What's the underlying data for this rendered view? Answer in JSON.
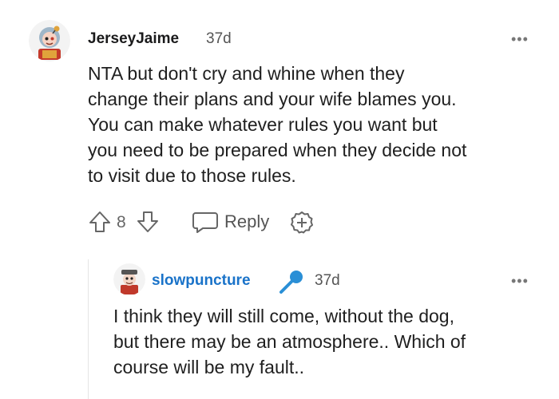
{
  "comment": {
    "username": "JerseyJaime",
    "age": "37d",
    "body": [
      "NTA but don't cry and whine when they",
      "change their plans and your wife blames you.",
      "You can make whatever rules you want but",
      "you need to be prepared when they decide not",
      "to visit due to those rules."
    ],
    "vote_count": "8",
    "reply_label": "Reply",
    "more_label": "•••"
  },
  "reply": {
    "username": "slowpuncture",
    "age": "37d",
    "body": [
      "I think they will still come, without the dog,",
      "but there may be an atmosphere.. Which of",
      "course will be my fault.."
    ],
    "more_label": "•••",
    "username_color": "#1a73c9",
    "mic_color": "#2a8fd6"
  }
}
